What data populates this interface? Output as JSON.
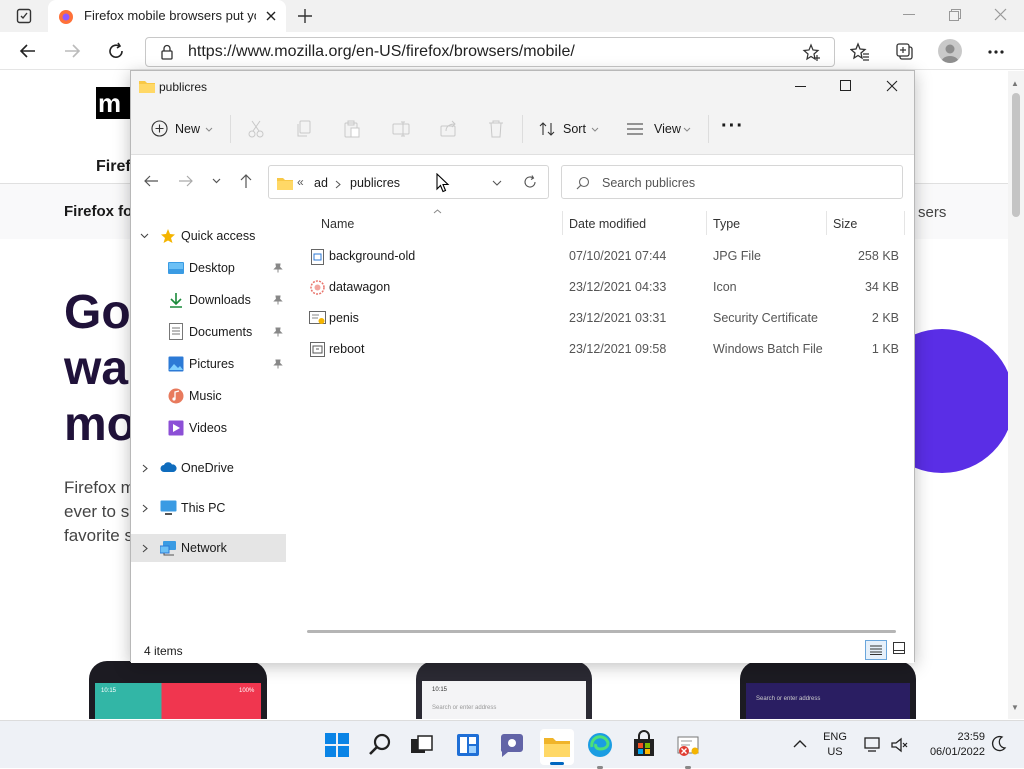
{
  "browser": {
    "tab_title": "Firefox mobile browsers put you",
    "url": "https://www.mozilla.org/en-US/firefox/browsers/mobile/"
  },
  "webpage": {
    "logo_text": "m",
    "nav_text": "Firefo",
    "subnav_left": "Firefox fo",
    "subnav_right": "sers",
    "heading_lines": [
      "Go",
      "wa",
      "mo"
    ],
    "para_lines": [
      "Firefox m",
      "ever to s",
      "favorite s"
    ],
    "phone_time": "10:15",
    "phone_battery": "100%",
    "phone_mid_search": "Search or enter address",
    "phone_right_search": "Search or enter address"
  },
  "explorer": {
    "title": "publicres",
    "toolbar": {
      "new": "New",
      "sort": "Sort",
      "view": "View",
      "more": "···"
    },
    "breadcrumb": {
      "chevron": "«",
      "segments": [
        "ad",
        "publicres"
      ]
    },
    "search_placeholder": "Search publicres",
    "columns": {
      "name": "Name",
      "date": "Date modified",
      "type": "Type",
      "size": "Size"
    },
    "files": [
      {
        "name": "background-old",
        "date": "07/10/2021 07:44",
        "type": "JPG File",
        "size": "258 KB",
        "icon": "image-file-icon"
      },
      {
        "name": "datawagon",
        "date": "23/12/2021 04:33",
        "type": "Icon",
        "size": "34 KB",
        "icon": "icon-file-icon"
      },
      {
        "name": "penis",
        "date": "23/12/2021 03:31",
        "type": "Security Certificate",
        "size": "2 KB",
        "icon": "certificate-icon"
      },
      {
        "name": "reboot",
        "date": "23/12/2021 09:58",
        "type": "Windows Batch File",
        "size": "1 KB",
        "icon": "batch-file-icon"
      }
    ],
    "nav": {
      "quick_access": "Quick access",
      "items": [
        "Desktop",
        "Downloads",
        "Documents",
        "Pictures",
        "Music",
        "Videos"
      ],
      "onedrive": "OneDrive",
      "thispc": "This PC",
      "network": "Network"
    },
    "status": "4 items"
  },
  "taskbar": {
    "lang_top": "ENG",
    "lang_bottom": "US",
    "time": "23:59",
    "date": "06/01/2022"
  },
  "colors": {
    "accent": "#0067c0",
    "folder": "#f8c846",
    "firefox_purple": "#5a2ee6"
  }
}
